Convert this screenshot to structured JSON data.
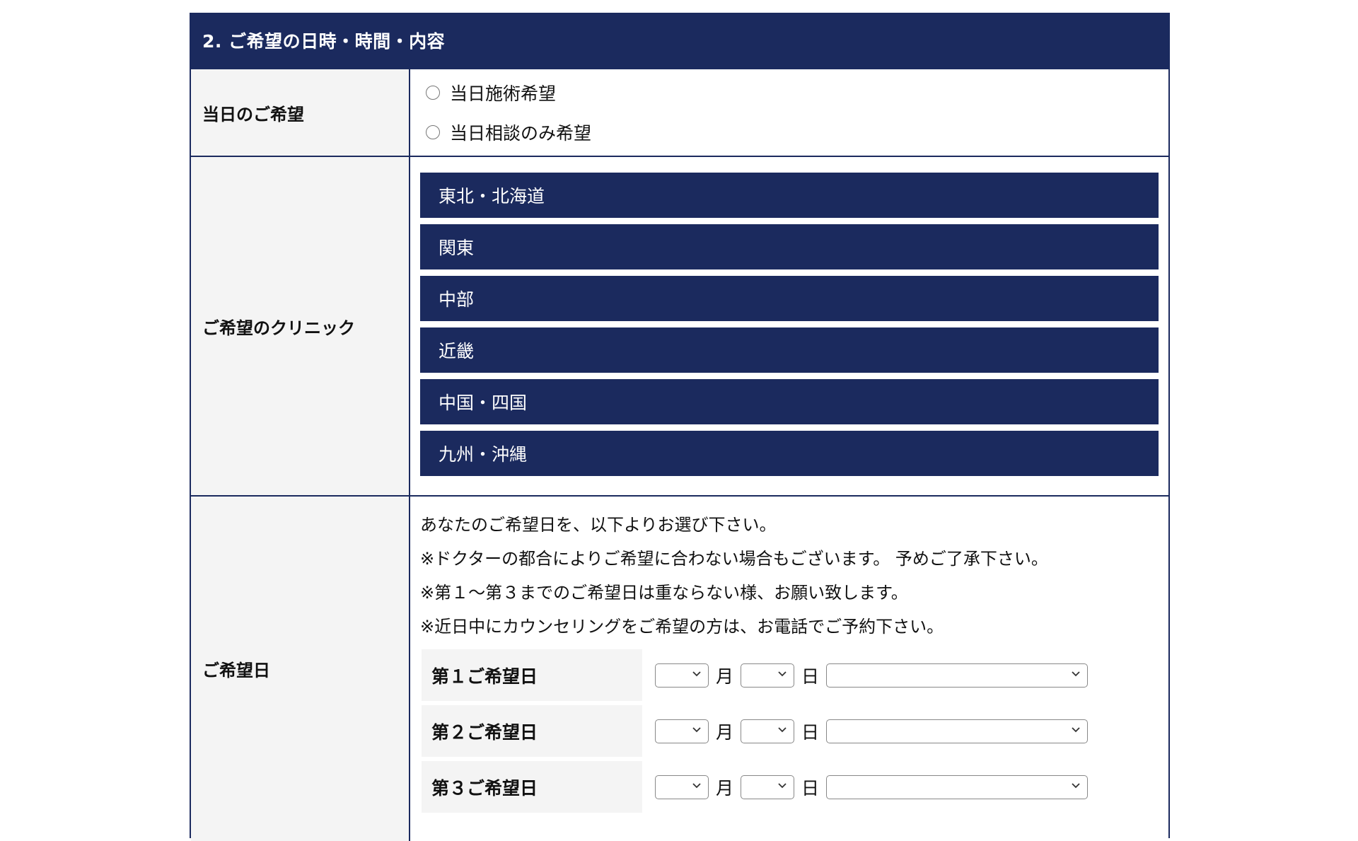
{
  "section": {
    "title": "2. ご希望の日時・時間・内容"
  },
  "visit_preference": {
    "label": "当日のご希望",
    "options": [
      "当日施術希望",
      "当日相談のみ希望"
    ]
  },
  "clinic": {
    "label": "ご希望のクリニック",
    "regions": [
      "東北・北海道",
      "関東",
      "中部",
      "近畿",
      "中国・四国",
      "九州・沖縄"
    ]
  },
  "preferred_date": {
    "label": "ご希望日",
    "notes": [
      "あなたのご希望日を、以下よりお選び下さい。",
      "※ドクターの都合によりご希望に合わない場合もございます。 予めご了承下さい。",
      "※第１〜第３までのご希望日は重ならない様、お願い致します。",
      "※近日中にカウンセリングをご希望の方は、お電話でご予約下さい。"
    ],
    "choices": [
      {
        "label": "第１ご希望日",
        "month_unit": "月",
        "day_unit": "日"
      },
      {
        "label": "第２ご希望日",
        "month_unit": "月",
        "day_unit": "日"
      },
      {
        "label": "第３ご希望日",
        "month_unit": "月",
        "day_unit": "日"
      }
    ]
  },
  "colors": {
    "navy": "#1b2a5e",
    "label_bg": "#f4f4f4"
  }
}
